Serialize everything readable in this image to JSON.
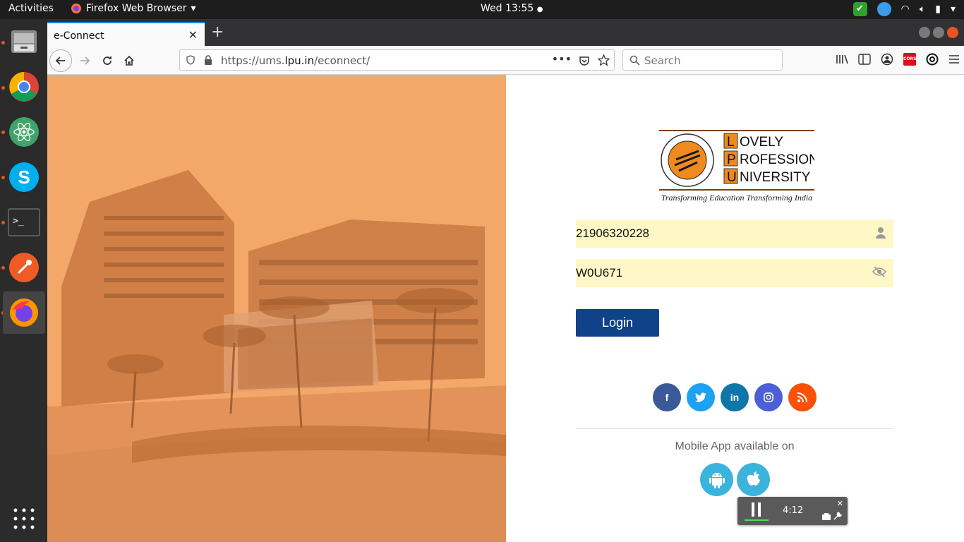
{
  "topbar": {
    "activities": "Activities",
    "app_name": "Firefox Web Browser",
    "clock": "Wed 13:55"
  },
  "dock": {
    "items": [
      "files",
      "chrome",
      "atom",
      "skype",
      "terminal",
      "postman",
      "firefox"
    ]
  },
  "browser": {
    "tab_title": "e-Connect",
    "url_prefix": "https://ums.",
    "url_domain": "lpu.in",
    "url_path": "/econnect/",
    "search_placeholder": "Search"
  },
  "logo": {
    "letters": [
      "L",
      "P",
      "U"
    ],
    "words": [
      "OVELY",
      "ROFESSIONAL",
      "NIVERSITY"
    ],
    "tagline": "Transforming Education Transforming India"
  },
  "login": {
    "username_value": "21906320228",
    "password_value": "W0U671",
    "login_label": "Login"
  },
  "social": {
    "colors": {
      "facebook": "#3b5998",
      "twitter": "#1da1f2",
      "linkedin": "#0e76a8",
      "instagram": "#4c5fd7",
      "blog": "#fc4f08"
    }
  },
  "mobile": {
    "text": "Mobile App available on"
  },
  "recorder": {
    "time": "4:12"
  }
}
